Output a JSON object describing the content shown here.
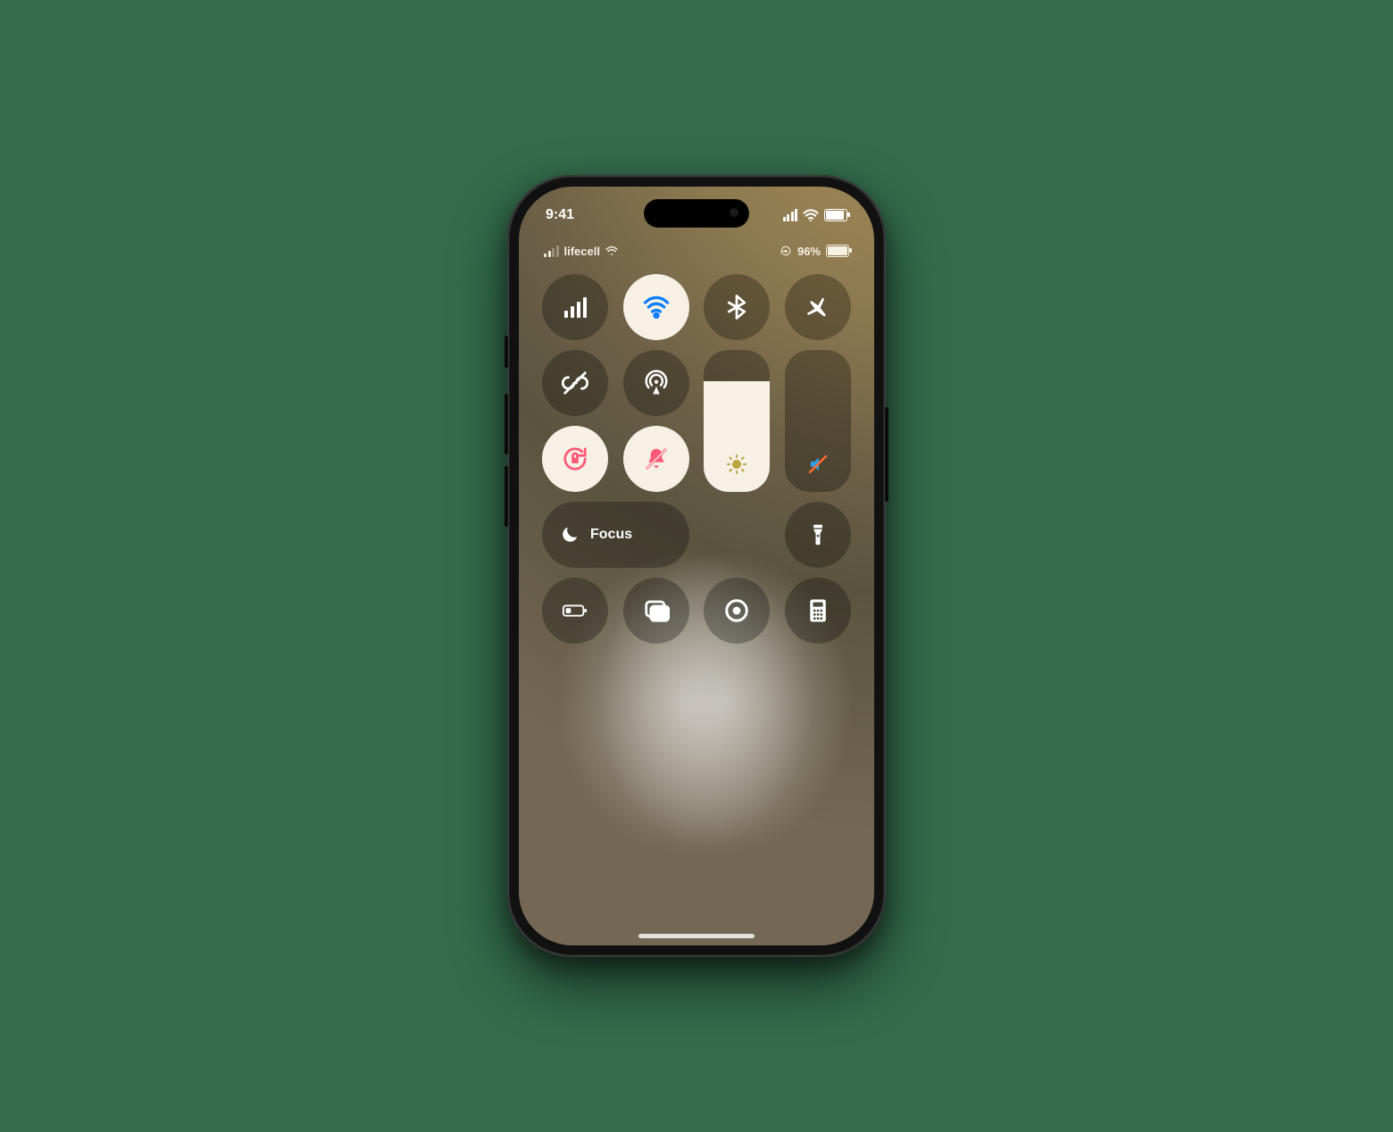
{
  "outer_status": {
    "time": "9:41"
  },
  "cc_status": {
    "carrier": "lifecell",
    "battery_pct": "96%"
  },
  "sliders": {
    "brightness_pct": 78,
    "volume_pct": 0
  },
  "focus": {
    "label": "Focus"
  },
  "icons": {
    "cellular": "cellular-icon",
    "wifi": "wifi-icon",
    "bluetooth": "bluetooth-icon",
    "airplane": "airplane-icon",
    "vpn": "vpn-icon",
    "airdrop": "airdrop-icon",
    "rotation_lock": "rotation-lock-icon",
    "silent": "silent-icon",
    "brightness": "brightness-icon",
    "volume_mute": "volume-mute-icon",
    "flashlight": "flashlight-icon",
    "low_power": "low-power-icon",
    "mirroring": "screen-mirroring-icon",
    "screen_record": "screen-record-icon",
    "calculator": "calculator-icon",
    "moon": "moon-icon"
  }
}
